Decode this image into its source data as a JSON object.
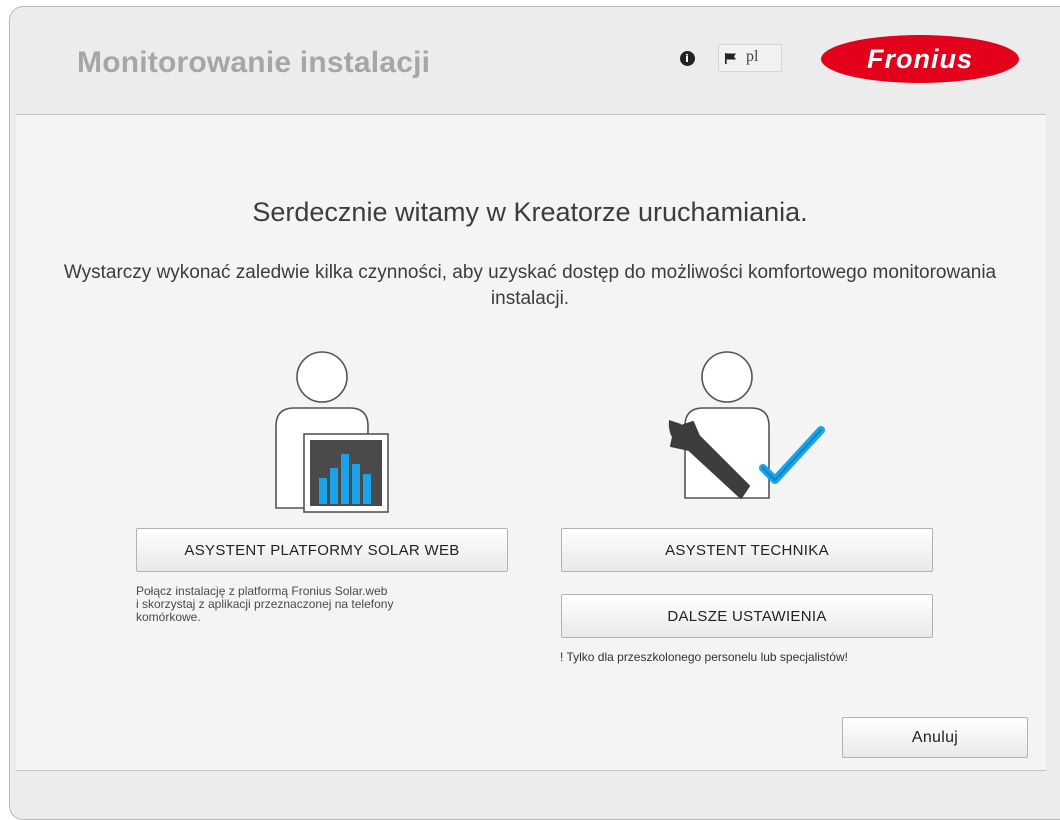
{
  "header": {
    "title": "Monitorowanie instalacji",
    "info_icon": "info-icon",
    "flag_icon": "flag-icon",
    "language": "pl",
    "logo_text": "Fronius",
    "logo_color": "#e2001a"
  },
  "welcome": {
    "title": "Serdecznie witamy w Kreatorze uruchamiania.",
    "description": "Wystarczy wykonać zaledwie kilka czynności, aby uzyskać dostęp do możliwości komfortowego monitorowania instalacji."
  },
  "left": {
    "illustration_icon": "user-monitor-chart-icon",
    "button_label": "ASYSTENT PLATFORMY SOLAR WEB",
    "description_lines": [
      "Połącz instalację z platformą Fronius Solar.web",
      "i skorzystaj z aplikacji przeznaczonej na telefony",
      "komórkowe."
    ]
  },
  "right": {
    "illustration_icon": "user-wrench-checkmark-icon",
    "technician_label": "ASYSTENT TECHNIKA",
    "settings_label": "DALSZE USTAWIENIA",
    "warning": "! Tylko dla przeszkolonego personelu lub specjalistów!"
  },
  "footer": {
    "cancel_label": "Anuluj"
  },
  "colors": {
    "accent_blue": "#1aa3e8",
    "brand_red": "#e2001a",
    "title_gray": "#a6a6a6"
  }
}
